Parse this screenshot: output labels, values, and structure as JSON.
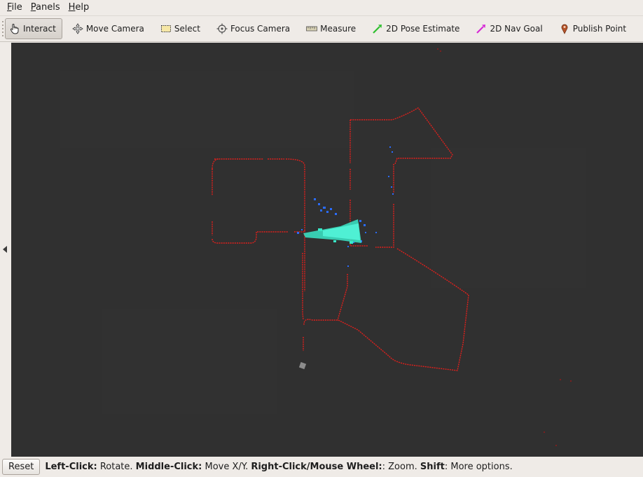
{
  "menu": [
    {
      "mnemonic": "F",
      "rest": "ile"
    },
    {
      "mnemonic": "P",
      "rest": "anels"
    },
    {
      "mnemonic": "H",
      "rest": "elp"
    }
  ],
  "toolbar": {
    "interact": "Interact",
    "move_camera": "Move Camera",
    "select": "Select",
    "focus_camera": "Focus Camera",
    "measure": "Measure",
    "pose_estimate": "2D Pose Estimate",
    "nav_goal": "2D Nav Goal",
    "publish_point": "Publish Point",
    "active_tool": "Interact"
  },
  "colors": {
    "viewport_bg": "#303030",
    "laser_scan": "#e0201c",
    "pointcloud_cyan": "#39e8c8",
    "pointcloud_blue": "#2a6cff",
    "robot_marker": "#8c8c8c"
  },
  "statusbar": {
    "reset": "Reset",
    "help": [
      {
        "key": "Left-Click:",
        "text": " Rotate. "
      },
      {
        "key": "Middle-Click:",
        "text": " Move X/Y. "
      },
      {
        "key": "Right-Click/Mouse Wheel:",
        "text": ": Zoom. "
      },
      {
        "key": "Shift",
        "text": ": More options."
      }
    ]
  }
}
